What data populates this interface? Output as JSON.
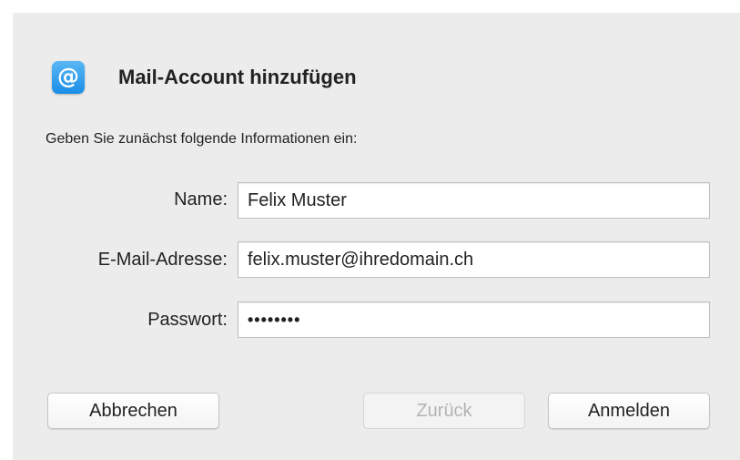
{
  "dialog": {
    "icon": "@",
    "title": "Mail-Account hinzufügen",
    "subtitle": "Geben Sie zunächst folgende Informationen ein:"
  },
  "form": {
    "name_label": "Name:",
    "name_value": "Felix Muster",
    "email_label": "E-Mail-Adresse:",
    "email_value": "felix.muster@ihredomain.ch",
    "password_label": "Passwort:",
    "password_value": "••••••••"
  },
  "buttons": {
    "cancel": "Abbrechen",
    "back": "Zurück",
    "sign_in": "Anmelden"
  }
}
